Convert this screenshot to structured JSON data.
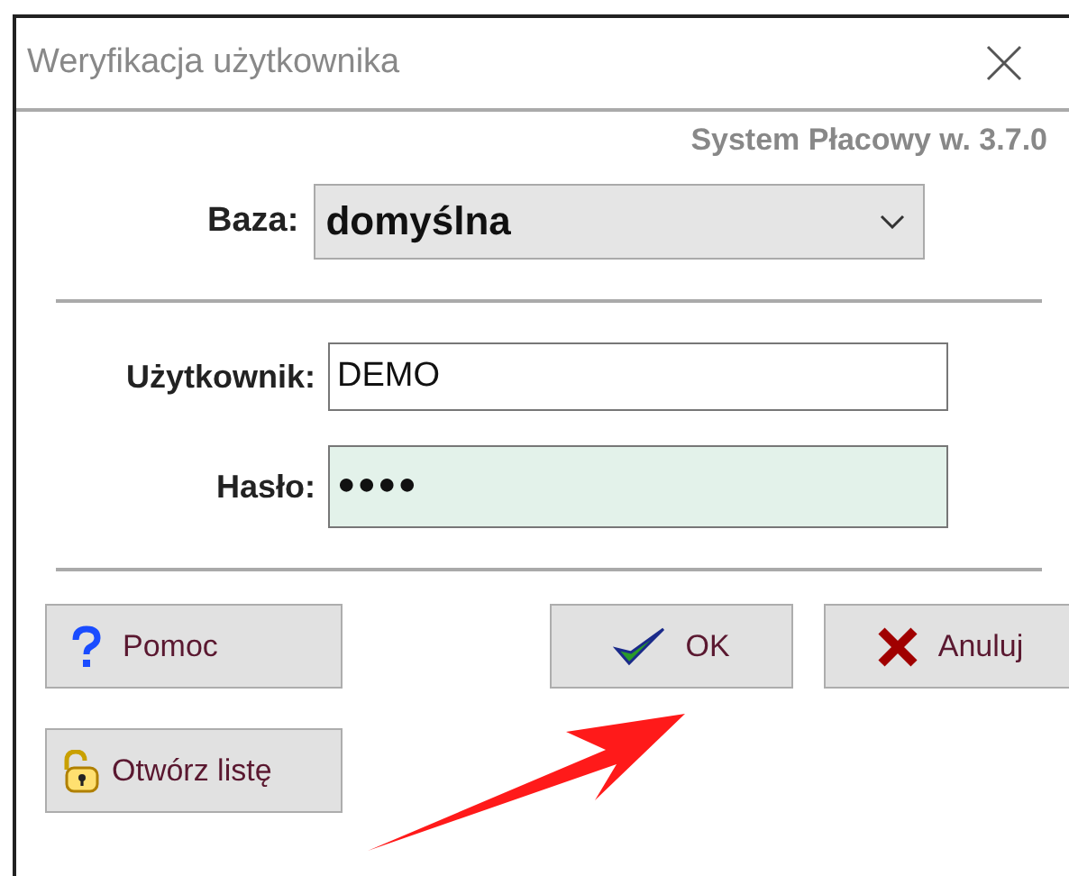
{
  "window": {
    "title": "Weryfikacja użytkownika"
  },
  "app_version": "System Płacowy w. 3.7.0",
  "database": {
    "label": "Baza:",
    "value": "domyślna"
  },
  "fields": [
    {
      "label": "Użytkownik:",
      "value": "DEMO",
      "kind": "text"
    },
    {
      "label": "Hasło:",
      "value": "●●●●",
      "kind": "password"
    }
  ],
  "button_rows": [
    {
      "buttons": [
        {
          "label": "Pomoc",
          "kind": "help"
        },
        {
          "label": "OK",
          "kind": "ok"
        },
        {
          "label": "Anuluj",
          "kind": "cancel"
        }
      ]
    },
    {
      "buttons": [
        {
          "label": "Otwórz listę",
          "kind": "open-list"
        }
      ]
    }
  ]
}
